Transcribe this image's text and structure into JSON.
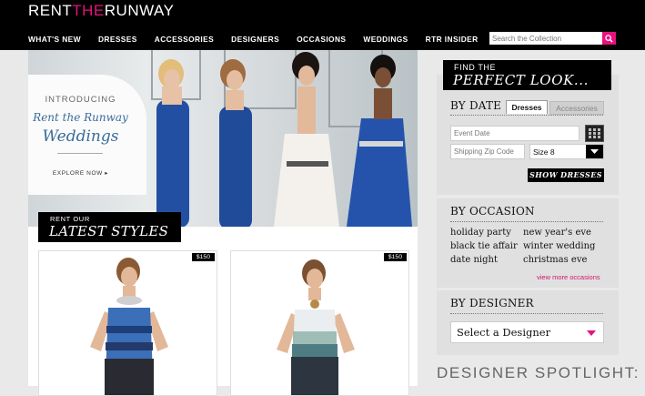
{
  "header": {
    "logo": {
      "pre": "RENT",
      "mid": "THE",
      "post": "RUNWAY"
    },
    "nav": [
      "WHAT'S NEW",
      "DRESSES",
      "ACCESSORIES",
      "DESIGNERS",
      "OCCASIONS",
      "WEDDINGS",
      "RTR INSIDER"
    ],
    "search_placeholder": "Search the Collection",
    "search_icon": "search-icon"
  },
  "hero": {
    "intro": "INTRODUCING",
    "line2": "Rent the Runway",
    "line3": "Weddings",
    "cta": "EXPLORE NOW ▸"
  },
  "styles_banner": {
    "top": "RENT OUR",
    "bottom": "LATEST STYLES"
  },
  "products": [
    {
      "price": "$150"
    },
    {
      "price": "$150"
    }
  ],
  "sidebar": {
    "find": {
      "top": "FIND THE",
      "bottom": "PERFECT LOOK..."
    },
    "by_date": {
      "title": "BY DATE",
      "tabs": [
        "Dresses",
        "Accessories"
      ],
      "event_date_placeholder": "Event Date",
      "zip_placeholder": "Shipping Zip Code",
      "size_value": "Size 8",
      "button": "SHOW DRESSES"
    },
    "by_occasion": {
      "title": "BY OCCASION",
      "left": [
        "holiday party",
        "black tie affair",
        "date night"
      ],
      "right": [
        "new year's eve",
        "winter wedding",
        "christmas eve"
      ],
      "more": "view more occasions"
    },
    "by_designer": {
      "title": "BY DESIGNER",
      "select_value": "Select a Designer"
    },
    "spotlight": "DESIGNER SPOTLIGHT:"
  },
  "colors": {
    "accent": "#e6127e",
    "black": "#000000",
    "dress_blue": "#1f4fa6"
  }
}
